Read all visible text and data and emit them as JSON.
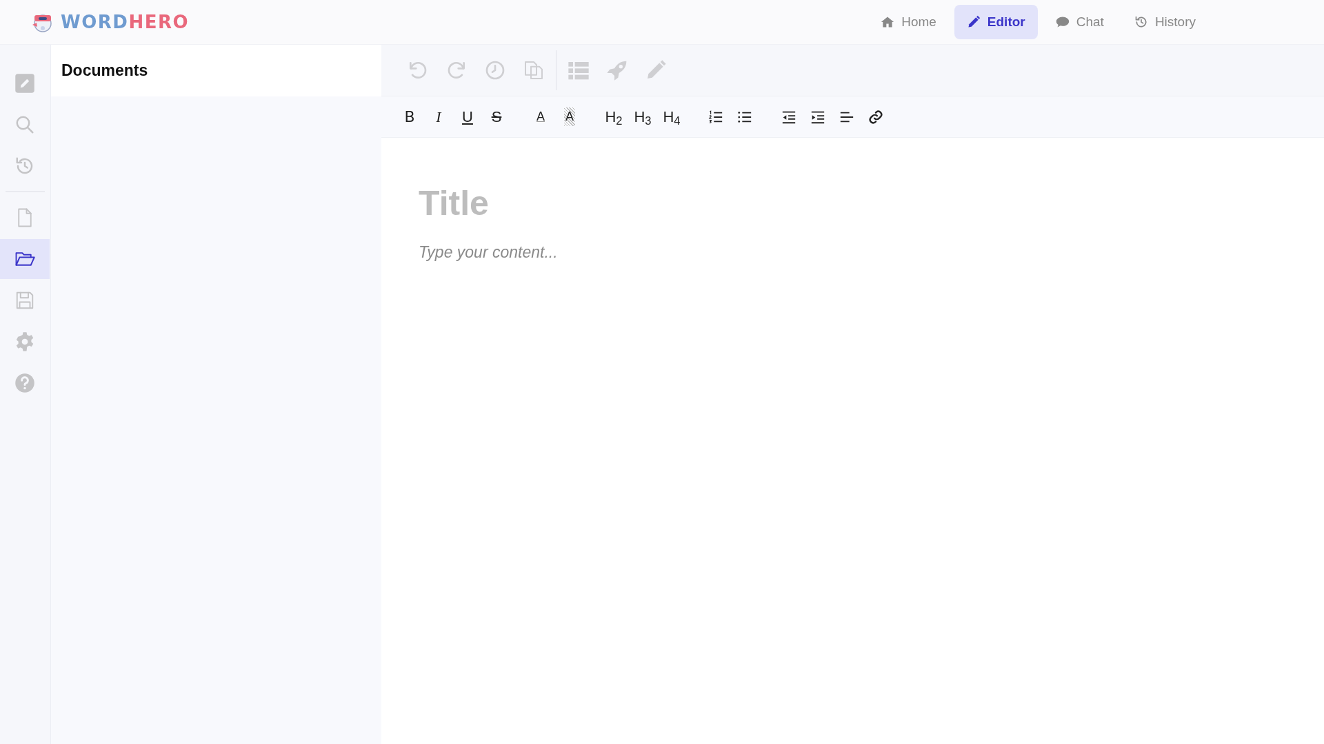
{
  "logo": {
    "parts": [
      {
        "text": "WORD",
        "color": "#6f9bd0"
      },
      {
        "text": "HERO",
        "color": "#e9687c"
      }
    ]
  },
  "nav": [
    {
      "label": "Home",
      "selected": false
    },
    {
      "label": "Editor",
      "selected": true
    },
    {
      "label": "Chat",
      "selected": false
    },
    {
      "label": "History",
      "selected": false
    }
  ],
  "rail": {
    "groups": [
      [
        {
          "selected": false
        },
        {
          "selected": false
        },
        {
          "selected": false
        }
      ],
      [
        {
          "selected": false
        },
        {
          "selected": true
        },
        {
          "selected": false
        },
        {
          "selected": false
        },
        {
          "selected": false
        }
      ]
    ]
  },
  "documents_panel": {
    "title": "Documents"
  },
  "toolbar_top": {
    "groups": [
      [
        {
          "disabled": true
        },
        {
          "disabled": true
        },
        {
          "disabled": true
        },
        {
          "disabled": true
        }
      ],
      [
        {
          "disabled": true
        },
        {
          "disabled": true
        },
        {
          "disabled": true
        }
      ]
    ]
  },
  "toolbar_format": {
    "groups": [
      [
        {
          "kind": "text",
          "label": "B"
        },
        {
          "kind": "text",
          "label": "I"
        },
        {
          "kind": "text",
          "label": "U"
        },
        {
          "kind": "text",
          "label": "S"
        }
      ],
      [
        {
          "kind": "text",
          "label": "A"
        },
        {
          "kind": "text",
          "label": "A"
        }
      ],
      [
        {
          "kind": "text",
          "label": "H$_{2}$"
        },
        {
          "kind": "text",
          "label": "H$_{3}$"
        },
        {
          "kind": "text",
          "label": "H$_{4}$"
        }
      ],
      [
        {
          "kind": "icon"
        },
        {
          "kind": "icon"
        }
      ],
      [
        {
          "kind": "icon"
        },
        {
          "kind": "icon"
        },
        {
          "kind": "icon"
        },
        {
          "kind": "icon"
        }
      ]
    ]
  },
  "editor": {
    "title_placeholder": "Title",
    "content_placeholder": "Type your content..."
  }
}
